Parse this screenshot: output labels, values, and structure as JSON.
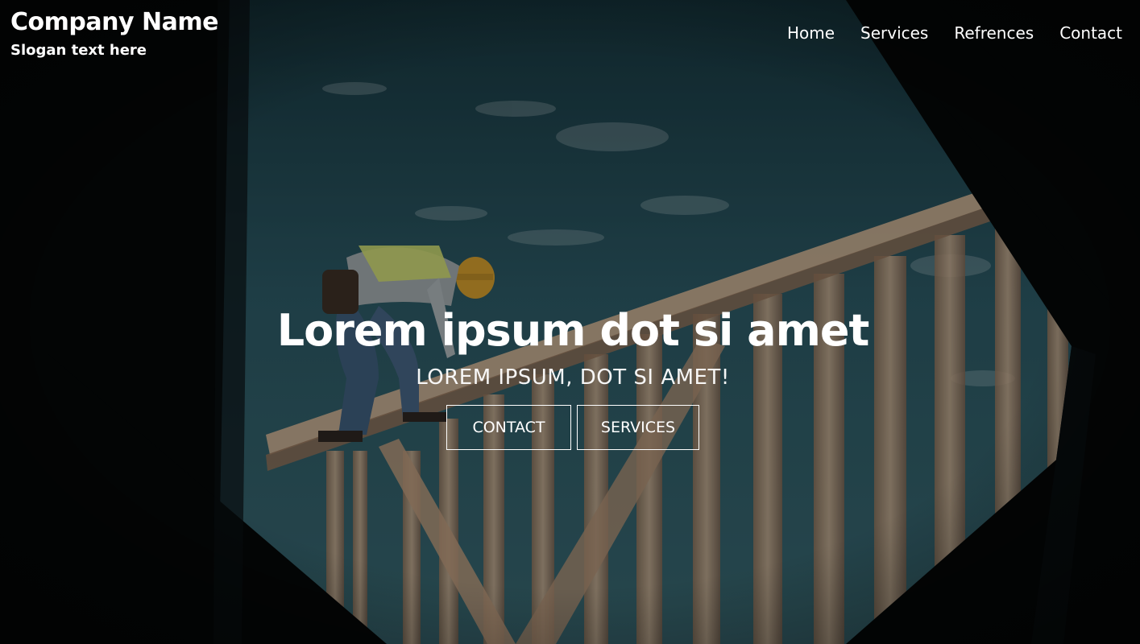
{
  "header": {
    "company_name": "Company Name",
    "slogan": "Slogan text here"
  },
  "nav": {
    "items": [
      {
        "label": "Home"
      },
      {
        "label": "Services"
      },
      {
        "label": "Refrences"
      },
      {
        "label": "Contact"
      }
    ]
  },
  "hero": {
    "headline": "Lorem ipsum dot si amet",
    "subheadline": "LOREM IPSUM, DOT SI AMET!",
    "buttons": {
      "contact_label": "CONTACT",
      "services_label": "SERVICES"
    }
  },
  "colors": {
    "sky_top": "#1f4650",
    "sky_bottom": "#2f5b66",
    "frame_dark": "#050708",
    "wood": "#b8987a",
    "text": "#ffffff"
  }
}
